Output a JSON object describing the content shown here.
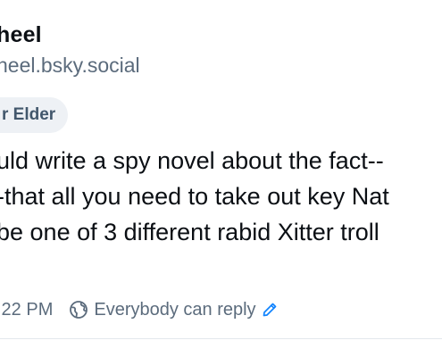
{
  "author": {
    "display_name": "heel",
    "handle": "heel.bsky.social"
  },
  "badge": {
    "label": "r Elder"
  },
  "post": {
    "lines": [
      "uld write a spy novel about the fact--",
      "-that all you need to take out key Nat",
      "be one of 3 different rabid Xitter troll"
    ]
  },
  "meta": {
    "time": ":22 PM",
    "reply_setting": "Everybody can reply",
    "globe_icon": "globe-icon",
    "edit_icon": "pencil-icon",
    "accent_color": "#1083fe"
  }
}
